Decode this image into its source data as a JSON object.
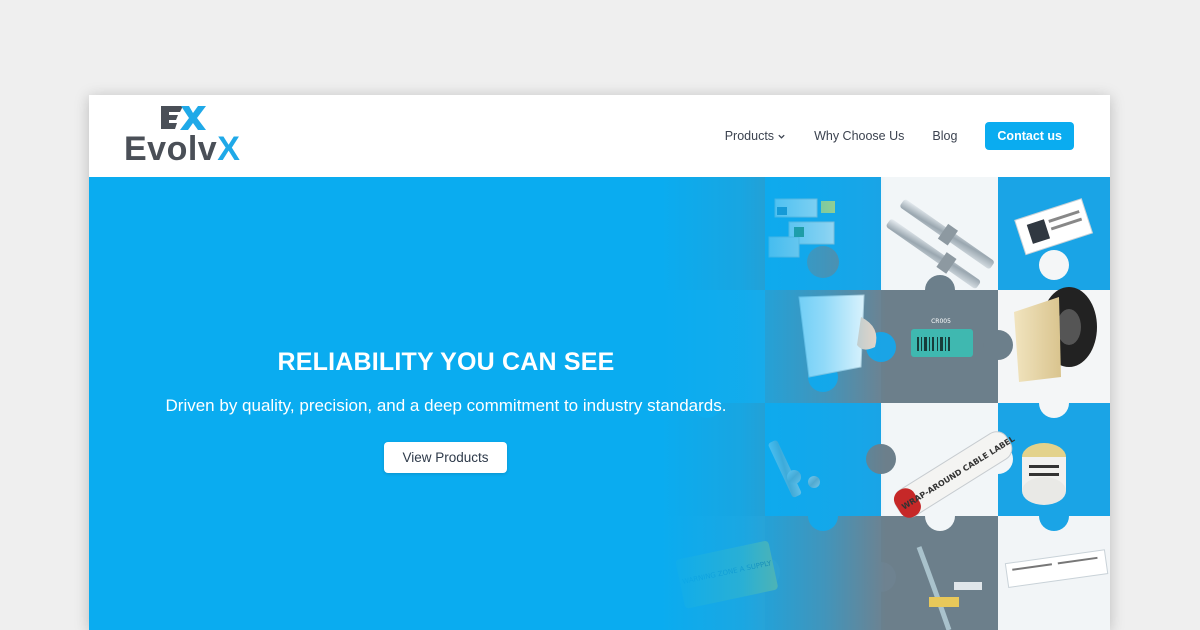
{
  "brand": {
    "name_part_a": "Evolv",
    "name_part_b": "X",
    "mark_text": "EX",
    "colors": {
      "dark": "#4a4f57",
      "accent": "#1fa9e8"
    }
  },
  "nav": {
    "products_label": "Products",
    "why_label": "Why Choose Us",
    "blog_label": "Blog",
    "contact_label": "Contact us"
  },
  "hero": {
    "title": "RELIABILITY YOU CAN SEE",
    "subtitle": "Driven by quality, precision, and a deep commitment to industry standards.",
    "cta_label": "View Products",
    "background_color": "#0aacf0"
  },
  "collage": {
    "label_cable": "WRAP-AROUND CABLE LABEL",
    "label_tag": "CR005",
    "label_warning": "WARNING ZONE A SUPPLY"
  }
}
